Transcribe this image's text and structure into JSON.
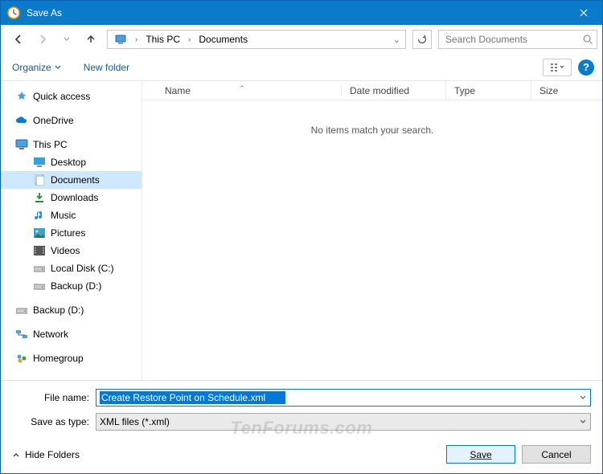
{
  "title": "Save As",
  "nav": {
    "crumb_root": "This PC",
    "crumb_leaf": "Documents"
  },
  "search": {
    "placeholder": "Search Documents"
  },
  "toolbar": {
    "organize": "Organize",
    "newfolder": "New folder"
  },
  "tree": {
    "quick_access": "Quick access",
    "onedrive": "OneDrive",
    "this_pc": "This PC",
    "desktop": "Desktop",
    "documents": "Documents",
    "downloads": "Downloads",
    "music": "Music",
    "pictures": "Pictures",
    "videos": "Videos",
    "localdisk": "Local Disk (C:)",
    "backup_d": "Backup (D:)",
    "backup_d2": "Backup (D:)",
    "network": "Network",
    "homegroup": "Homegroup"
  },
  "list": {
    "col_name": "Name",
    "col_date": "Date modified",
    "col_type": "Type",
    "col_size": "Size",
    "empty": "No items match your search."
  },
  "bottom": {
    "filename_label": "File name:",
    "filename_value": "Create Restore Point on Schedule.xml",
    "type_label": "Save as type:",
    "type_value": "XML files (*.xml)",
    "hide": "Hide Folders",
    "save": "Save",
    "cancel": "Cancel"
  },
  "watermark": "TenForums.com"
}
